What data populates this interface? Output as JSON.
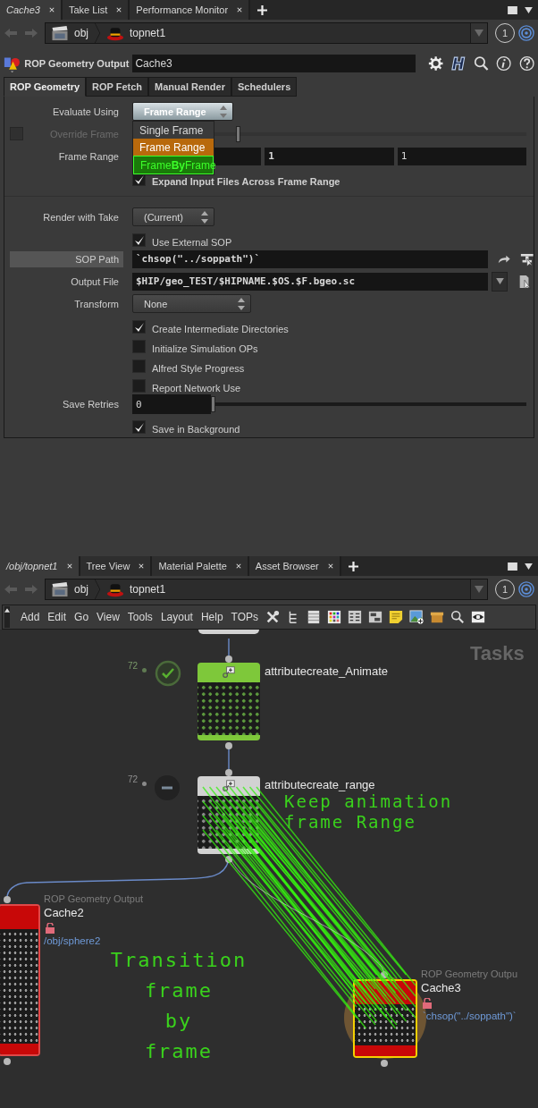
{
  "parameter_pane": {
    "tabs": [
      {
        "label": "Cache3",
        "selected": true
      },
      {
        "label": "Take List",
        "selected": false
      },
      {
        "label": "Performance Monitor",
        "selected": false
      }
    ],
    "path": {
      "items": [
        {
          "label": "obj",
          "kind": "object"
        },
        {
          "label": "topnet1",
          "kind": "top"
        }
      ],
      "pin": "1"
    },
    "node_type": "ROP Geometry Output",
    "node_name": "Cache3",
    "param_tabs": [
      {
        "label": "ROP Geometry",
        "selected": true
      },
      {
        "label": "ROP Fetch",
        "selected": false
      },
      {
        "label": "Manual Render",
        "selected": false
      },
      {
        "label": "Schedulers",
        "selected": false
      }
    ],
    "parameters": [
      {
        "kind": "menu",
        "label": "Evaluate Using",
        "value": "Frame Range",
        "modified": true,
        "open": true,
        "options": [
          {
            "label": "Single Frame",
            "selected": false,
            "kind": "plain"
          },
          {
            "label": "Frame Range",
            "selected": true,
            "kind": "plain"
          },
          {
            "label": "Frame**By**Frame",
            "selected": false,
            "kind": "highlighted"
          }
        ]
      },
      {
        "kind": "toggle_slider",
        "label": "Override Frame",
        "disabled": true,
        "checked": false,
        "level": 0.1
      },
      {
        "kind": "fields",
        "label": "Frame Range",
        "values": [
          {
            "value": "1",
            "modified": true
          },
          {
            "value": "1",
            "modified": false
          }
        ]
      },
      {
        "kind": "checkbox",
        "label": "Expand Input Files Across Frame Range",
        "checked": true,
        "modified": true
      },
      {
        "kind": "separator"
      },
      {
        "kind": "menu",
        "label": "Render with Take",
        "value": "(Current)",
        "modified": false,
        "open": false
      },
      {
        "kind": "checkbox",
        "label": "Use External SOP",
        "checked": true,
        "modified": false
      },
      {
        "kind": "node_path",
        "label": "SOP Path",
        "value": "`chsop(\"../soppath\")`",
        "modified": true,
        "highlighted": true
      },
      {
        "kind": "file_path",
        "label": "Output File",
        "value": "$HIP/geo_TEST/$HIPNAME.$OS.$F.bgeo.sc",
        "modified": true,
        "highlighted": false
      },
      {
        "kind": "menu",
        "label": "Transform",
        "value": "None",
        "modified": false,
        "open": false
      },
      {
        "kind": "checkbox",
        "label": "Create Intermediate Directories",
        "checked": true,
        "modified": false
      },
      {
        "kind": "checkbox",
        "label": "Initialize Simulation OPs",
        "checked": false,
        "modified": false
      },
      {
        "kind": "checkbox",
        "label": "Alfred Style Progress",
        "checked": false,
        "modified": false
      },
      {
        "kind": "checkbox",
        "label": "Report Network Use",
        "checked": false,
        "modified": false
      },
      {
        "kind": "int_slider",
        "label": "Save Retries",
        "value": "0",
        "level": 0
      },
      {
        "kind": "checkbox",
        "label": "Save in Background",
        "checked": true,
        "modified": false
      }
    ]
  },
  "network_pane": {
    "tabs": [
      {
        "label": "/obj/topnet1",
        "selected": true
      },
      {
        "label": "Tree View",
        "selected": false
      },
      {
        "label": "Material Palette",
        "selected": false
      },
      {
        "label": "Asset Browser",
        "selected": false
      }
    ],
    "path": {
      "items": [
        {
          "label": "obj",
          "kind": "object"
        },
        {
          "label": "topnet1",
          "kind": "top"
        }
      ],
      "pin": "1"
    },
    "menu": [
      "Add",
      "Edit",
      "Go",
      "View",
      "Tools",
      "Layout",
      "Help",
      "TOPs"
    ],
    "context_label": "Tasks",
    "nodes": [
      {
        "kind": "top",
        "name": "attributecreate_Animate",
        "count": "72",
        "cooked": true
      },
      {
        "kind": "top",
        "name": "attributecreate_range",
        "count": "72",
        "cooked": false
      },
      {
        "kind": "rop",
        "type": "ROP Geometry Output",
        "name": "Cache2",
        "detail": "/obj/sphere2",
        "selected": false
      },
      {
        "kind": "rop",
        "type": "ROP Geometry Outpu",
        "name": "Cache3",
        "detail": "`chsop(\"../soppath\")`",
        "selected": true
      }
    ],
    "annotations": [
      {
        "lines": [
          "Keep animation",
          "frame Range"
        ]
      },
      {
        "lines": [
          "Transition",
          "frame",
          "by",
          "frame"
        ]
      }
    ]
  }
}
